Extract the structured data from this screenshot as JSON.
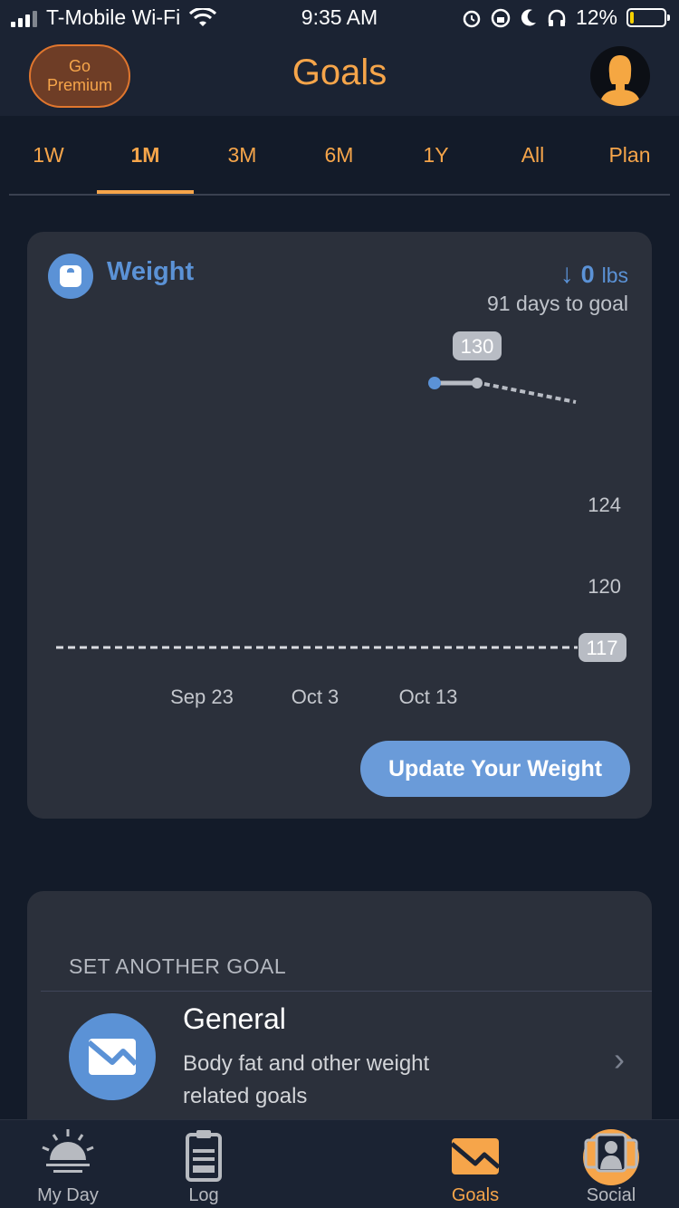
{
  "status_bar": {
    "carrier": "T-Mobile Wi-Fi",
    "time": "9:35 AM",
    "battery_percent": "12%",
    "battery_level": 0.12,
    "icons": [
      "signal-icon",
      "wifi-icon",
      "alarm-icon",
      "rotation-lock-icon",
      "moon-icon",
      "headphones-icon",
      "battery-icon"
    ]
  },
  "header": {
    "premium_label": "Go Premium",
    "title": "Goals"
  },
  "tabs": [
    {
      "label": "1W",
      "active": false
    },
    {
      "label": "1M",
      "active": true
    },
    {
      "label": "3M",
      "active": false
    },
    {
      "label": "6M",
      "active": false
    },
    {
      "label": "1Y",
      "active": false
    },
    {
      "label": "All",
      "active": false
    },
    {
      "label": "Plan",
      "active": false
    }
  ],
  "weight_card": {
    "title": "Weight",
    "delta_value": "0",
    "delta_unit": "lbs",
    "days_to_goal": "91 days to goal",
    "update_button": "Update Your Weight"
  },
  "chart_data": {
    "type": "line",
    "x_tick_labels": [
      "Sep 23",
      "Oct 3",
      "Oct 13"
    ],
    "y_tick_labels": [
      "124",
      "120"
    ],
    "current_label": "130",
    "goal_label": "117",
    "goal_value": 117,
    "points": [
      {
        "date": "Oct 13",
        "value": 130
      },
      {
        "date": "Oct 15",
        "value": 130
      }
    ],
    "projection_end": {
      "date": "Oct 20",
      "value": 129
    },
    "colors": {
      "actual": "#5b92d6",
      "projection": "#b8bcc4",
      "goal": "#d9dbe0",
      "label_bg": "#b8bcc4"
    }
  },
  "goal_section": {
    "heading": "SET ANOTHER GOAL",
    "item_title": "General",
    "item_description": "Body fat and other weight related goals"
  },
  "bottom_nav": [
    {
      "label": "My Day",
      "icon": "sunrise-icon",
      "active": false
    },
    {
      "label": "Log",
      "icon": "clipboard-icon",
      "active": false
    },
    {
      "label": "",
      "icon": "add-icon",
      "active": false
    },
    {
      "label": "Goals",
      "icon": "goals-chart-icon",
      "active": true
    },
    {
      "label": "Social",
      "icon": "social-people-icon",
      "active": false
    }
  ],
  "colors": {
    "accent": "#f6a54a",
    "blue": "#5b92d6",
    "background": "#131b29",
    "card": "#2b303b"
  }
}
